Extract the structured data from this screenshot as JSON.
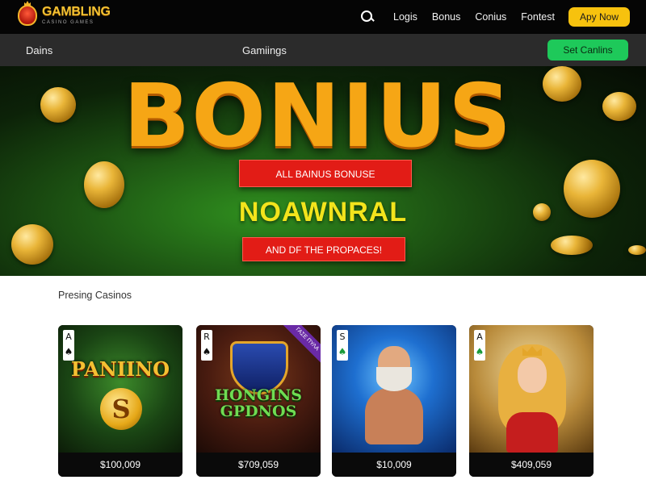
{
  "brand": {
    "name": "GAMBLING",
    "tagline": "CASINO GAMES"
  },
  "nav": {
    "links": [
      "Logis",
      "Bonus",
      "Conius",
      "Fontest"
    ],
    "cta": "Apy Now"
  },
  "subnav": {
    "left": "Dains",
    "center": "Gamiings",
    "cta": "Set Canlins"
  },
  "hero": {
    "title": "BONIUS",
    "banner_top": "ALL BAINUS BONUSE",
    "middle": "NOAWNRAL",
    "banner_bottom": "AND DF THE PROPACES!"
  },
  "section": {
    "title": "Presing Casinos"
  },
  "cards": [
    {
      "rank": "A",
      "suit": "♠",
      "logo": "PANIINO",
      "price": "$100,009"
    },
    {
      "rank": "R",
      "suit": "♠",
      "logo": "HONGINS GPDNOS",
      "ribbon": "ΓΑΣΕ ΠΥΛΑ",
      "price": "$709,059"
    },
    {
      "rank": "S",
      "suit": "♠",
      "price": "$10,009"
    },
    {
      "rank": "A",
      "suit": "♠",
      "price": "$409,059"
    }
  ],
  "colors": {
    "accent_yellow": "#f7c20e",
    "accent_green": "#1ec95a",
    "banner_red": "#e21c16",
    "hero_title": "#f6a615"
  }
}
